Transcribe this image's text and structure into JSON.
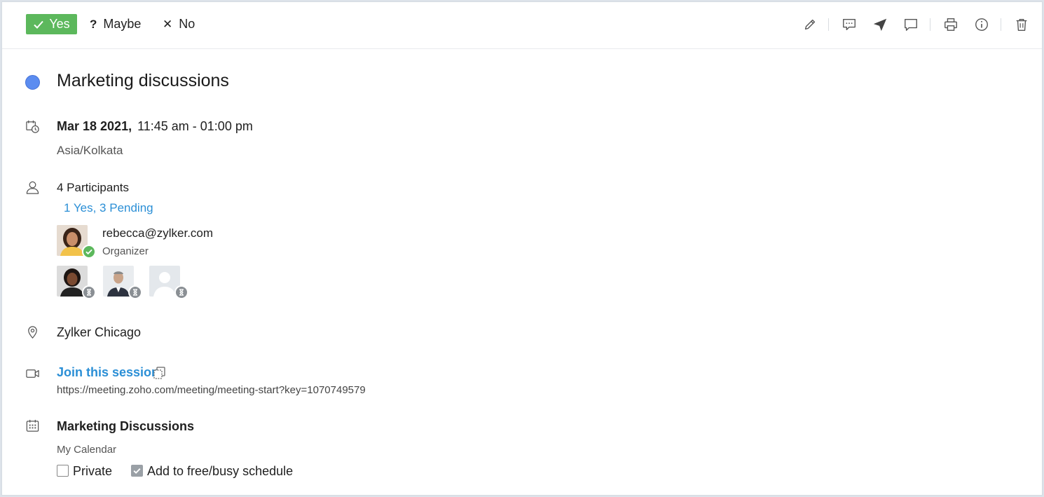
{
  "rsvp": {
    "yes_label": "Yes",
    "maybe_glyph": "?",
    "maybe_label": "Maybe",
    "no_glyph": "✕",
    "no_label": "No",
    "yes_color": "#5cb85c"
  },
  "toolbar_icons": [
    "edit-icon",
    "comment-icon",
    "send-icon",
    "chat-icon",
    "print-icon",
    "info-icon",
    "delete-icon"
  ],
  "event": {
    "title": "Marketing discussions",
    "color": "#5b8cf0",
    "date": "Mar 18 2021,",
    "time": "11:45 am - 01:00 pm",
    "timezone": "Asia/Kolkata"
  },
  "participants": {
    "count_label": "4 Participants",
    "summary": "1 Yes, 3 Pending",
    "organizer": {
      "email": "rebecca@zylker.com",
      "role": "Organizer",
      "status": "accepted"
    },
    "others": [
      {
        "status": "pending"
      },
      {
        "status": "pending"
      },
      {
        "status": "pending"
      }
    ]
  },
  "location": "Zylker Chicago",
  "meeting": {
    "join_label": "Join this session",
    "url": "https://meeting.zoho.com/meeting/meeting-start?key=1070749579"
  },
  "calendar": {
    "name": "Marketing Discussions",
    "owner": "My Calendar",
    "private_label": "Private",
    "private_checked": false,
    "freebusy_label": "Add to free/busy schedule",
    "freebusy_checked": true
  },
  "colors": {
    "link": "#2b8fd6",
    "accepted_badge": "#5cb85c",
    "pending_badge": "#8a8f94"
  }
}
